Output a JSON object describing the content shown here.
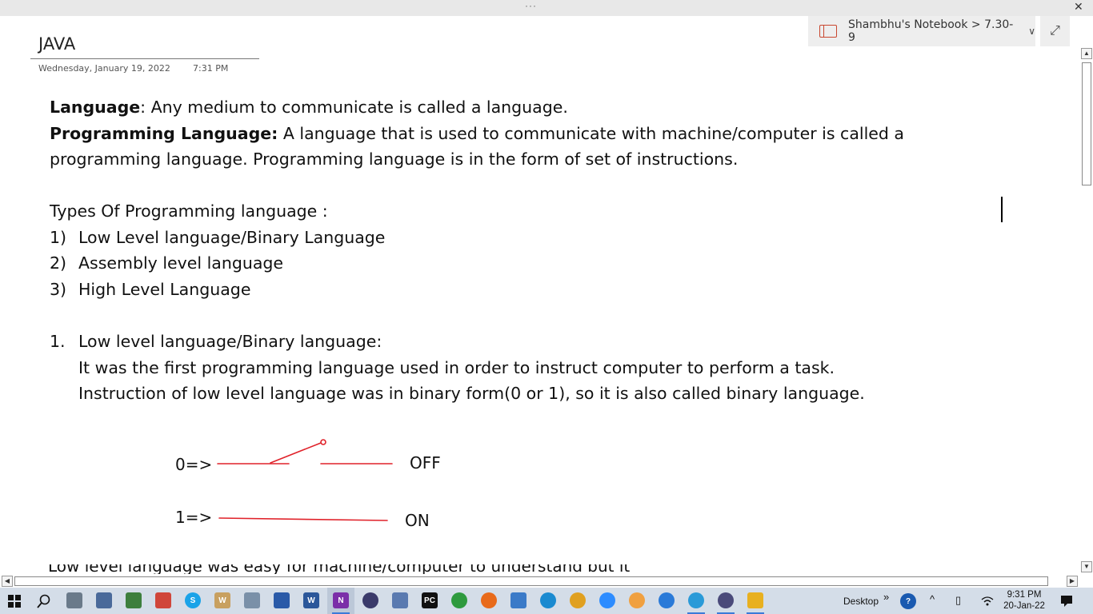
{
  "window": {
    "more_glyph": "···",
    "close_glyph": "✕"
  },
  "page": {
    "title": "JAVA",
    "date": "Wednesday, January 19, 2022",
    "time": "7:31 PM"
  },
  "breadcrumb": {
    "text": "Shambhu's Notebook > 7.30-9",
    "icon": "notebook-icon",
    "chevron": "∨",
    "expand_glyph": "⤢"
  },
  "content": {
    "p1_bold": "Language",
    "p1_text": ": Any medium to communicate is called a language.",
    "p2_bold": "Programming Language:",
    "p2_text": " A language that is used to communicate with machine/computer is called a",
    "p2_cont": "programming language. Programming language is in the form of set of instructions.",
    "types_heading": "Types Of Programming language :",
    "types": [
      {
        "num": "1)",
        "label": "Low Level language/Binary Language"
      },
      {
        "num": "2)",
        "label": "Assembly level language"
      },
      {
        "num": "3)",
        "label": "High Level Language"
      }
    ],
    "section1_num": "1.",
    "section1_title": "Low level language/Binary language:",
    "section1_line1": "It was the first programming language used in order to instruct  computer to perform a task.",
    "section1_line2": "Instruction of low level language was in binary form(0 or 1), so it is also called binary language.",
    "cut_line": "Low level language was easy for machine/computer to understand but it"
  },
  "drawing": {
    "zero_label": "0=>",
    "off_label": "OFF",
    "one_label": "1=>",
    "on_label": "ON",
    "line_color": "#e0222a"
  },
  "taskbar": {
    "desktop_label": "Desktop",
    "overflow_glyph": "»",
    "clock_time": "9:31 PM",
    "clock_date": "20-Jan-22"
  }
}
